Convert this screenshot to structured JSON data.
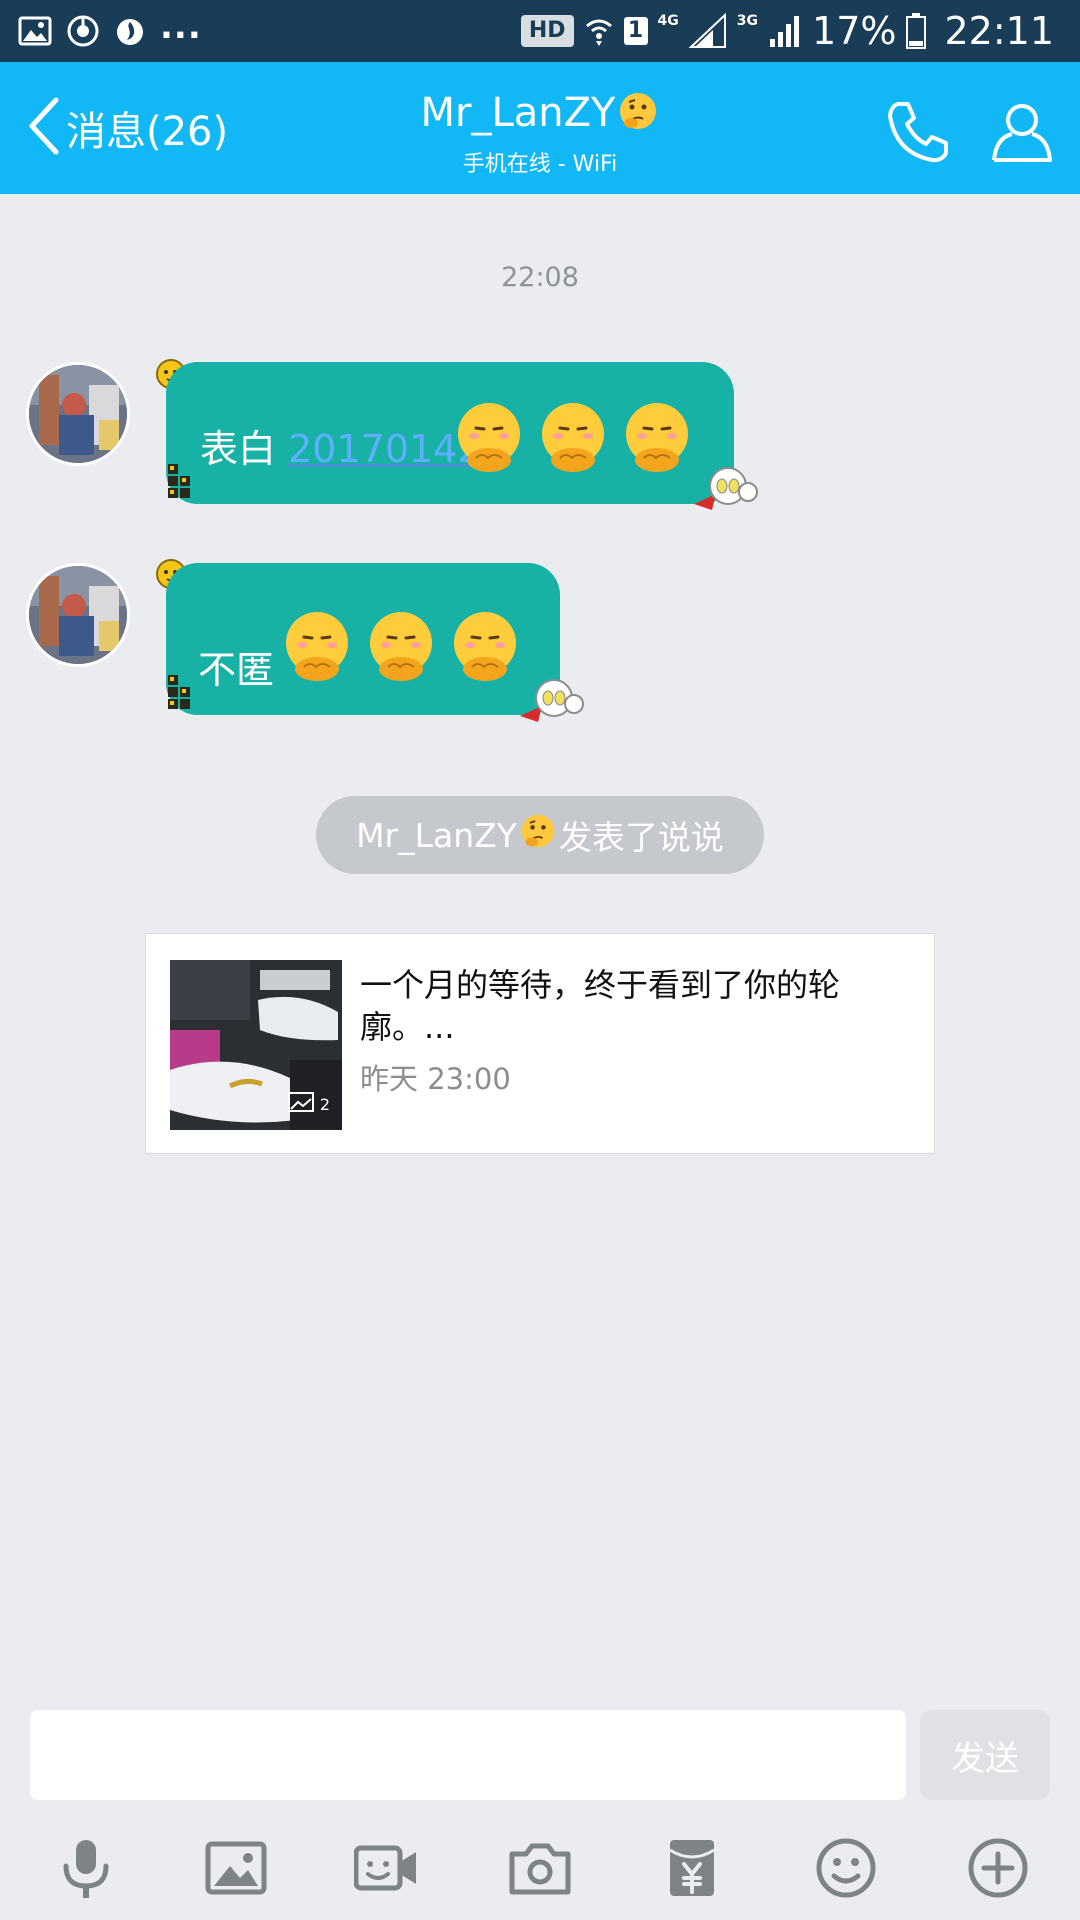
{
  "status_bar": {
    "left_dots": "...",
    "hd_label": "HD",
    "sim_label": "1",
    "network_1": "4G",
    "network_2": "3G",
    "battery": "17%",
    "time": "22:11"
  },
  "header": {
    "back_label": "消息(26)",
    "title": "Mr_LanZY",
    "subtitle": "手机在线 - WiFi"
  },
  "conversation": {
    "timestamp": "22:08",
    "messages": [
      {
        "text": "表白",
        "link": "20170142"
      },
      {
        "text": "不匿"
      }
    ],
    "system_notice": {
      "name": "Mr_LanZY",
      "action": "发表了说说"
    },
    "share_card": {
      "text": "一个月的等待，终于看到了你的轮廓。...",
      "time": "昨天 23:00",
      "photo_count": "2"
    }
  },
  "input": {
    "placeholder": "",
    "send_label": "发送"
  },
  "colors": {
    "status_bar": "#1a3d57",
    "header": "#12b7f5",
    "bubble": "#17b1a6",
    "background": "#ebecf0"
  },
  "icons": {
    "toolbar": [
      "microphone-icon",
      "image-icon",
      "video-icon",
      "camera-icon",
      "red-packet-icon",
      "emoji-icon",
      "plus-icon"
    ]
  }
}
